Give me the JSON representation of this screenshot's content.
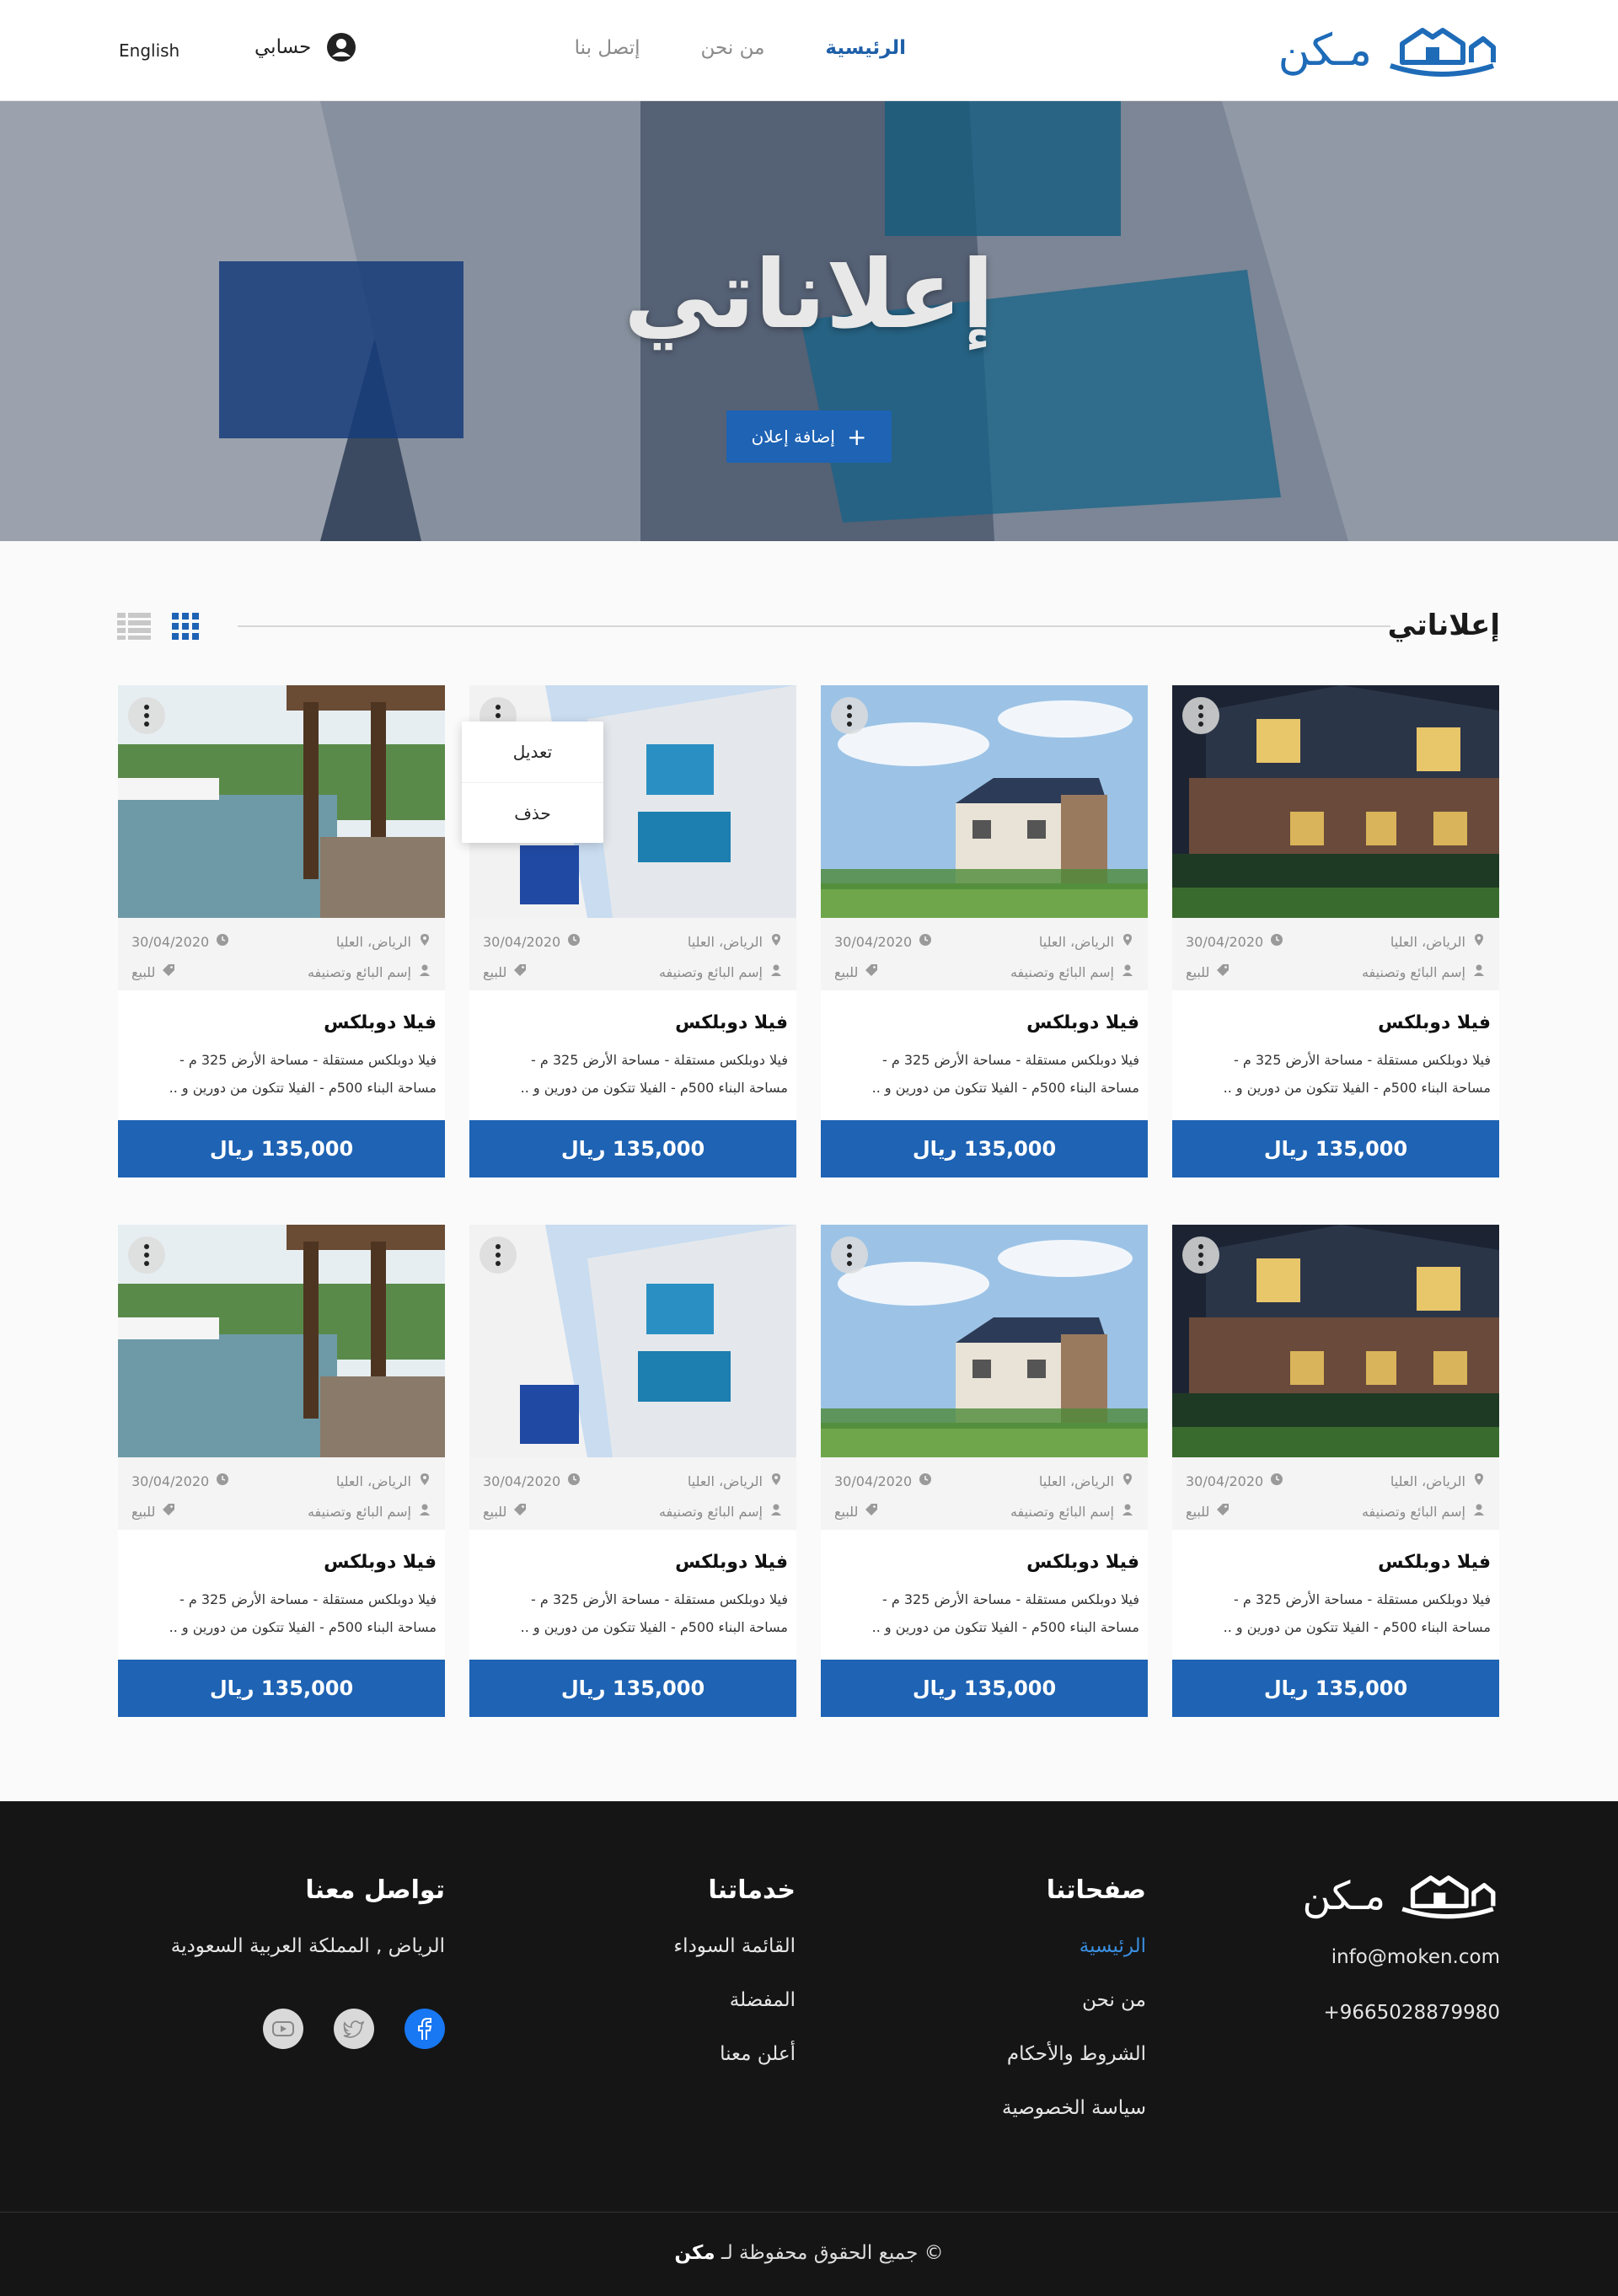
{
  "brand": {
    "name": "مـكن",
    "color": "#1e6bb8"
  },
  "nav": {
    "links": [
      {
        "label": "الرئيسية",
        "active": true
      },
      {
        "label": "من نحن",
        "active": false
      },
      {
        "label": "إتصل بنا",
        "active": false
      }
    ],
    "account_label": "حسابي",
    "language": "English"
  },
  "hero": {
    "title": "إعلاناتي",
    "add_button": "إضافة إعلان"
  },
  "section": {
    "title": "إعلاناتي"
  },
  "dropdown": {
    "edit": "تعديل",
    "delete": "حذف"
  },
  "cards": [
    {
      "image": "house-night",
      "location": "الرياض، العليا",
      "date": "30/04/2020",
      "seller": "إسم البائع وتصنيفه",
      "status": "للبيع",
      "title": "فيلا دوبلكس",
      "desc_line1": "فيلا دوبلكس مستقلة - مساحة الأرض 325 م -",
      "desc_line2": "مساحة البناء 500م - الفيلا تتكون من دورين و ..",
      "price": "135,000 ريال"
    },
    {
      "image": "house-day",
      "location": "الرياض، العليا",
      "date": "30/04/2020",
      "seller": "إسم البائع وتصنيفه",
      "status": "للبيع",
      "title": "فيلا دوبلكس",
      "desc_line1": "فيلا دوبلكس مستقلة - مساحة الأرض 325 م -",
      "desc_line2": "مساحة البناء 500م - الفيلا تتكون من دورين و ..",
      "price": "135,000 ريال"
    },
    {
      "image": "balcony",
      "location": "الرياض، العليا",
      "date": "30/04/2020",
      "seller": "إسم البائع وتصنيفه",
      "status": "للبيع",
      "title": "فيلا دوبلكس",
      "desc_line1": "فيلا دوبلكس مستقلة - مساحة الأرض 325 م -",
      "desc_line2": "مساحة البناء 500م - الفيلا تتكون من دورين و ..",
      "price": "135,000 ريال"
    },
    {
      "image": "pool",
      "location": "الرياض، العليا",
      "date": "30/04/2020",
      "seller": "إسم البائع وتصنيفه",
      "status": "للبيع",
      "title": "فيلا دوبلكس",
      "desc_line1": "فيلا دوبلكس مستقلة - مساحة الأرض 325 م -",
      "desc_line2": "مساحة البناء 500م - الفيلا تتكون من دورين و ..",
      "price": "135,000 ريال"
    },
    {
      "image": "house-night",
      "location": "الرياض، العليا",
      "date": "30/04/2020",
      "seller": "إسم البائع وتصنيفه",
      "status": "للبيع",
      "title": "فيلا دوبلكس",
      "desc_line1": "فيلا دوبلكس مستقلة - مساحة الأرض 325 م -",
      "desc_line2": "مساحة البناء 500م - الفيلا تتكون من دورين و ..",
      "price": "135,000 ريال"
    },
    {
      "image": "house-day",
      "location": "الرياض، العليا",
      "date": "30/04/2020",
      "seller": "إسم البائع وتصنيفه",
      "status": "للبيع",
      "title": "فيلا دوبلكس",
      "desc_line1": "فيلا دوبلكس مستقلة - مساحة الأرض 325 م -",
      "desc_line2": "مساحة البناء 500م - الفيلا تتكون من دورين و ..",
      "price": "135,000 ريال"
    },
    {
      "image": "balcony",
      "location": "الرياض، العليا",
      "date": "30/04/2020",
      "seller": "إسم البائع وتصنيفه",
      "status": "للبيع",
      "title": "فيلا دوبلكس",
      "desc_line1": "فيلا دوبلكس مستقلة - مساحة الأرض 325 م -",
      "desc_line2": "مساحة البناء 500م - الفيلا تتكون من دورين و ..",
      "price": "135,000 ريال"
    },
    {
      "image": "pool",
      "location": "الرياض، العليا",
      "date": "30/04/2020",
      "seller": "إسم البائع وتصنيفه",
      "status": "للبيع",
      "title": "فيلا دوبلكس",
      "desc_line1": "فيلا دوبلكس مستقلة - مساحة الأرض 325 م -",
      "desc_line2": "مساحة البناء 500م - الفيلا تتكون من دورين و ..",
      "price": "135,000 ريال"
    }
  ],
  "footer": {
    "brand": "مـكن",
    "email": "info@moken.com",
    "phone": "+9665028879980",
    "pages": {
      "title": "صفحاتنا",
      "links": [
        "الرئيسية",
        "من نحن",
        "الشروط والأحكام",
        "سياسة الخصوصية"
      ]
    },
    "services": {
      "title": "خدماتنا",
      "links": [
        "القائمة السوداء",
        "المفضلة",
        "أعلن معنا"
      ]
    },
    "contact": {
      "title": "تواصل معنا",
      "address": "الرياض , المملكة العربية السعودية"
    },
    "social": [
      "facebook-icon",
      "twitter-icon",
      "youtube-icon"
    ],
    "copyright_prefix": "جميع الحقوق محفوظة لـ",
    "copyright_brand": "مكن",
    "copyright_symbol": "©"
  }
}
